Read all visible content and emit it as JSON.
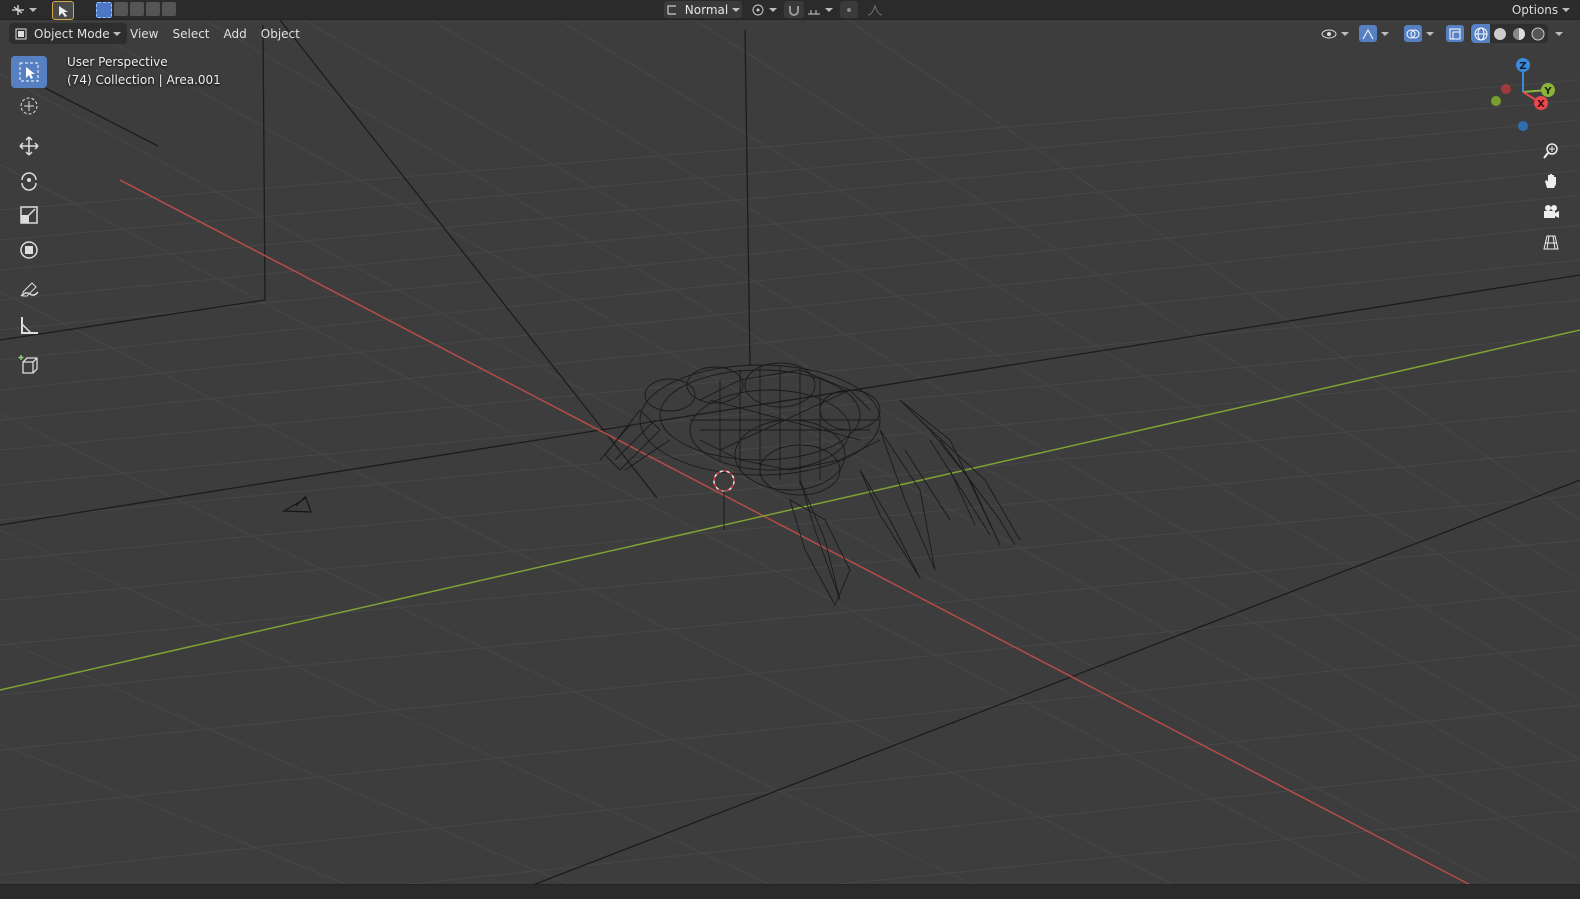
{
  "toolbar_top": {
    "transform_orientation": "Normal",
    "options_label": "Options"
  },
  "header": {
    "mode_label": "Object Mode",
    "menu": [
      "View",
      "Select",
      "Add",
      "Object"
    ]
  },
  "viewport": {
    "perspective_label": "User Perspective",
    "collection_label": "(74) Collection | Area.001"
  },
  "gizmo": {
    "z_label": "Z",
    "y_label": "Y",
    "x_label": "X"
  },
  "colors": {
    "viewport_bg": "#3d3d3d",
    "grid_line": "#464646",
    "x_axis": "#b64b4b",
    "y_axis": "#7ea333",
    "active_tool": "#5680c2",
    "gizmo_x": "#e8474e",
    "gizmo_y": "#8ab43a",
    "gizmo_z": "#3b8bdb"
  },
  "icons": {
    "tools": [
      "select-box-icon",
      "cursor-icon",
      "move-icon",
      "rotate-icon",
      "scale-icon",
      "transform-icon",
      "annotate-icon",
      "measure-icon",
      "add-cube-icon"
    ],
    "nav": [
      "zoom-icon",
      "hand-icon",
      "camera-icon",
      "grid-view-icon"
    ]
  }
}
